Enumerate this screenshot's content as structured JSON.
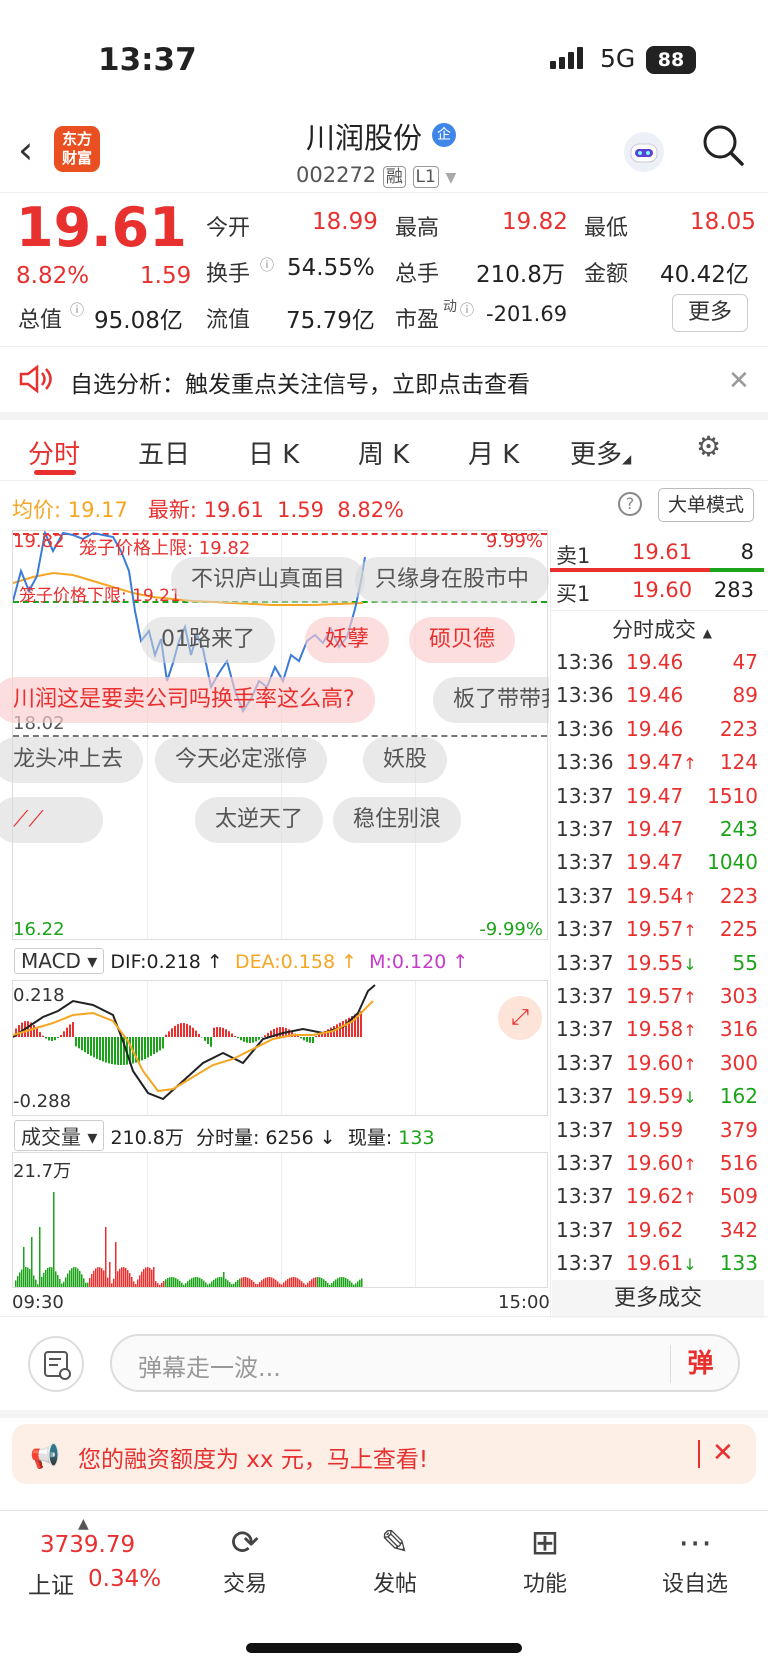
{
  "status_bar": {
    "time": "13:37",
    "network": "5G",
    "battery": "88"
  },
  "header": {
    "logo": "东方\n财富",
    "title": "川润股份",
    "title_badge": "企",
    "code": "002272",
    "tags": [
      "融",
      "L1"
    ]
  },
  "quote": {
    "price": "19.61",
    "pct": "8.82%",
    "change": "1.59",
    "open_label": "今开",
    "open": "18.99",
    "high_label": "最高",
    "high": "19.82",
    "low_label": "最低",
    "low": "18.05",
    "turnover_label": "换手",
    "turnover": "54.55%",
    "volume_label": "总手",
    "volume": "210.8万",
    "amount_label": "金额",
    "amount": "40.42亿",
    "mktcap_label": "总值",
    "mktcap": "95.08亿",
    "float_label": "流值",
    "float": "75.79亿",
    "pe_label": "市盈",
    "pe_sup": "动",
    "pe": "-201.69",
    "more_button": "更多"
  },
  "analysis_banner": {
    "text": "自选分析：触发重点关注信号，立即点击查看"
  },
  "tabs": [
    "分时",
    "五日",
    "日 K",
    "周 K",
    "月 K",
    "更多"
  ],
  "chart_header": {
    "avg_label": "均价:",
    "avg": "19.17",
    "latest_label": "最新:",
    "latest": "19.61",
    "change": "1.59",
    "pct": "8.82%",
    "big_order_button": "大单模式"
  },
  "chart": {
    "upper": "19.82",
    "upper_pct": "9.99%",
    "upper_limit_label": "笼子价格上限: 19.82",
    "lower_limit_label": "笼子价格下限: 19.21",
    "low_ref": "18.02",
    "bottom": "16.22",
    "bottom_pct": "-9.99%",
    "danmu": [
      "不识庐山真面目",
      "只缘身在股市中",
      "01路来了",
      "妖孽",
      "硕贝德",
      "川润这是要卖公司吗换手率这么高?",
      "板了带带我",
      "龙头冲上去",
      "今天必定涨停",
      "妖股",
      "太逆天了",
      "稳住别浪"
    ]
  },
  "macd": {
    "select": "MACD",
    "dif": "DIF:0.218",
    "dea": "DEA:0.158",
    "m": "M:0.120",
    "top": "0.218",
    "bottom": "-0.288"
  },
  "volume_ind": {
    "select": "成交量",
    "total": "210.8万",
    "minute_label": "分时量:",
    "minute": "6256",
    "now_label": "现量:",
    "now": "133",
    "max": "21.7万",
    "start": "09:30",
    "end": "15:00"
  },
  "order_book": {
    "sell1": {
      "label": "卖1",
      "price": "19.61",
      "qty": "8"
    },
    "buy1": {
      "label": "买1",
      "price": "19.60",
      "qty": "283"
    },
    "ticks_title": "分时成交",
    "ticks": [
      {
        "t": "13:36",
        "p": "19.46",
        "d": "",
        "v": "47",
        "c": "red"
      },
      {
        "t": "13:36",
        "p": "19.46",
        "d": "",
        "v": "89",
        "c": "red"
      },
      {
        "t": "13:36",
        "p": "19.46",
        "d": "",
        "v": "223",
        "c": "red"
      },
      {
        "t": "13:36",
        "p": "19.47",
        "d": "↑",
        "v": "124",
        "c": "red"
      },
      {
        "t": "13:37",
        "p": "19.47",
        "d": "",
        "v": "1510",
        "c": "red"
      },
      {
        "t": "13:37",
        "p": "19.47",
        "d": "",
        "v": "243",
        "c": "green"
      },
      {
        "t": "13:37",
        "p": "19.47",
        "d": "",
        "v": "1040",
        "c": "green"
      },
      {
        "t": "13:37",
        "p": "19.54",
        "d": "↑",
        "v": "223",
        "c": "red"
      },
      {
        "t": "13:37",
        "p": "19.57",
        "d": "↑",
        "v": "225",
        "c": "red"
      },
      {
        "t": "13:37",
        "p": "19.55",
        "d": "↓",
        "v": "55",
        "c": "green"
      },
      {
        "t": "13:37",
        "p": "19.57",
        "d": "↑",
        "v": "303",
        "c": "red"
      },
      {
        "t": "13:37",
        "p": "19.58",
        "d": "↑",
        "v": "316",
        "c": "red"
      },
      {
        "t": "13:37",
        "p": "19.60",
        "d": "↑",
        "v": "300",
        "c": "red"
      },
      {
        "t": "13:37",
        "p": "19.59",
        "d": "↓",
        "v": "162",
        "c": "green"
      },
      {
        "t": "13:37",
        "p": "19.59",
        "d": "",
        "v": "379",
        "c": "red"
      },
      {
        "t": "13:37",
        "p": "19.60",
        "d": "↑",
        "v": "516",
        "c": "red"
      },
      {
        "t": "13:37",
        "p": "19.62",
        "d": "↑",
        "v": "509",
        "c": "red"
      },
      {
        "t": "13:37",
        "p": "19.62",
        "d": "",
        "v": "342",
        "c": "red"
      },
      {
        "t": "13:37",
        "p": "19.61",
        "d": "↓",
        "v": "133",
        "c": "green"
      }
    ],
    "more_button": "更多成交"
  },
  "comment": {
    "placeholder": "弹幕走一波...",
    "send": "弹"
  },
  "promo": {
    "text": "您的融资额度为 xx 元，马上查看!"
  },
  "bottom_nav": {
    "index_value": "3739.79",
    "index_name": "上证",
    "index_pct": "0.34%",
    "items": [
      {
        "label": "交易",
        "icon": "yuan-exchange-icon"
      },
      {
        "label": "发帖",
        "icon": "edit-icon"
      },
      {
        "label": "功能",
        "icon": "grid-icon"
      },
      {
        "label": "设自选",
        "icon": "more-circle-icon"
      }
    ]
  },
  "colors": {
    "up": "#e8302f",
    "down": "#1ba31a",
    "avg": "#f5a623",
    "price_line": "#3b7bd9",
    "accent": "#e94f20"
  }
}
